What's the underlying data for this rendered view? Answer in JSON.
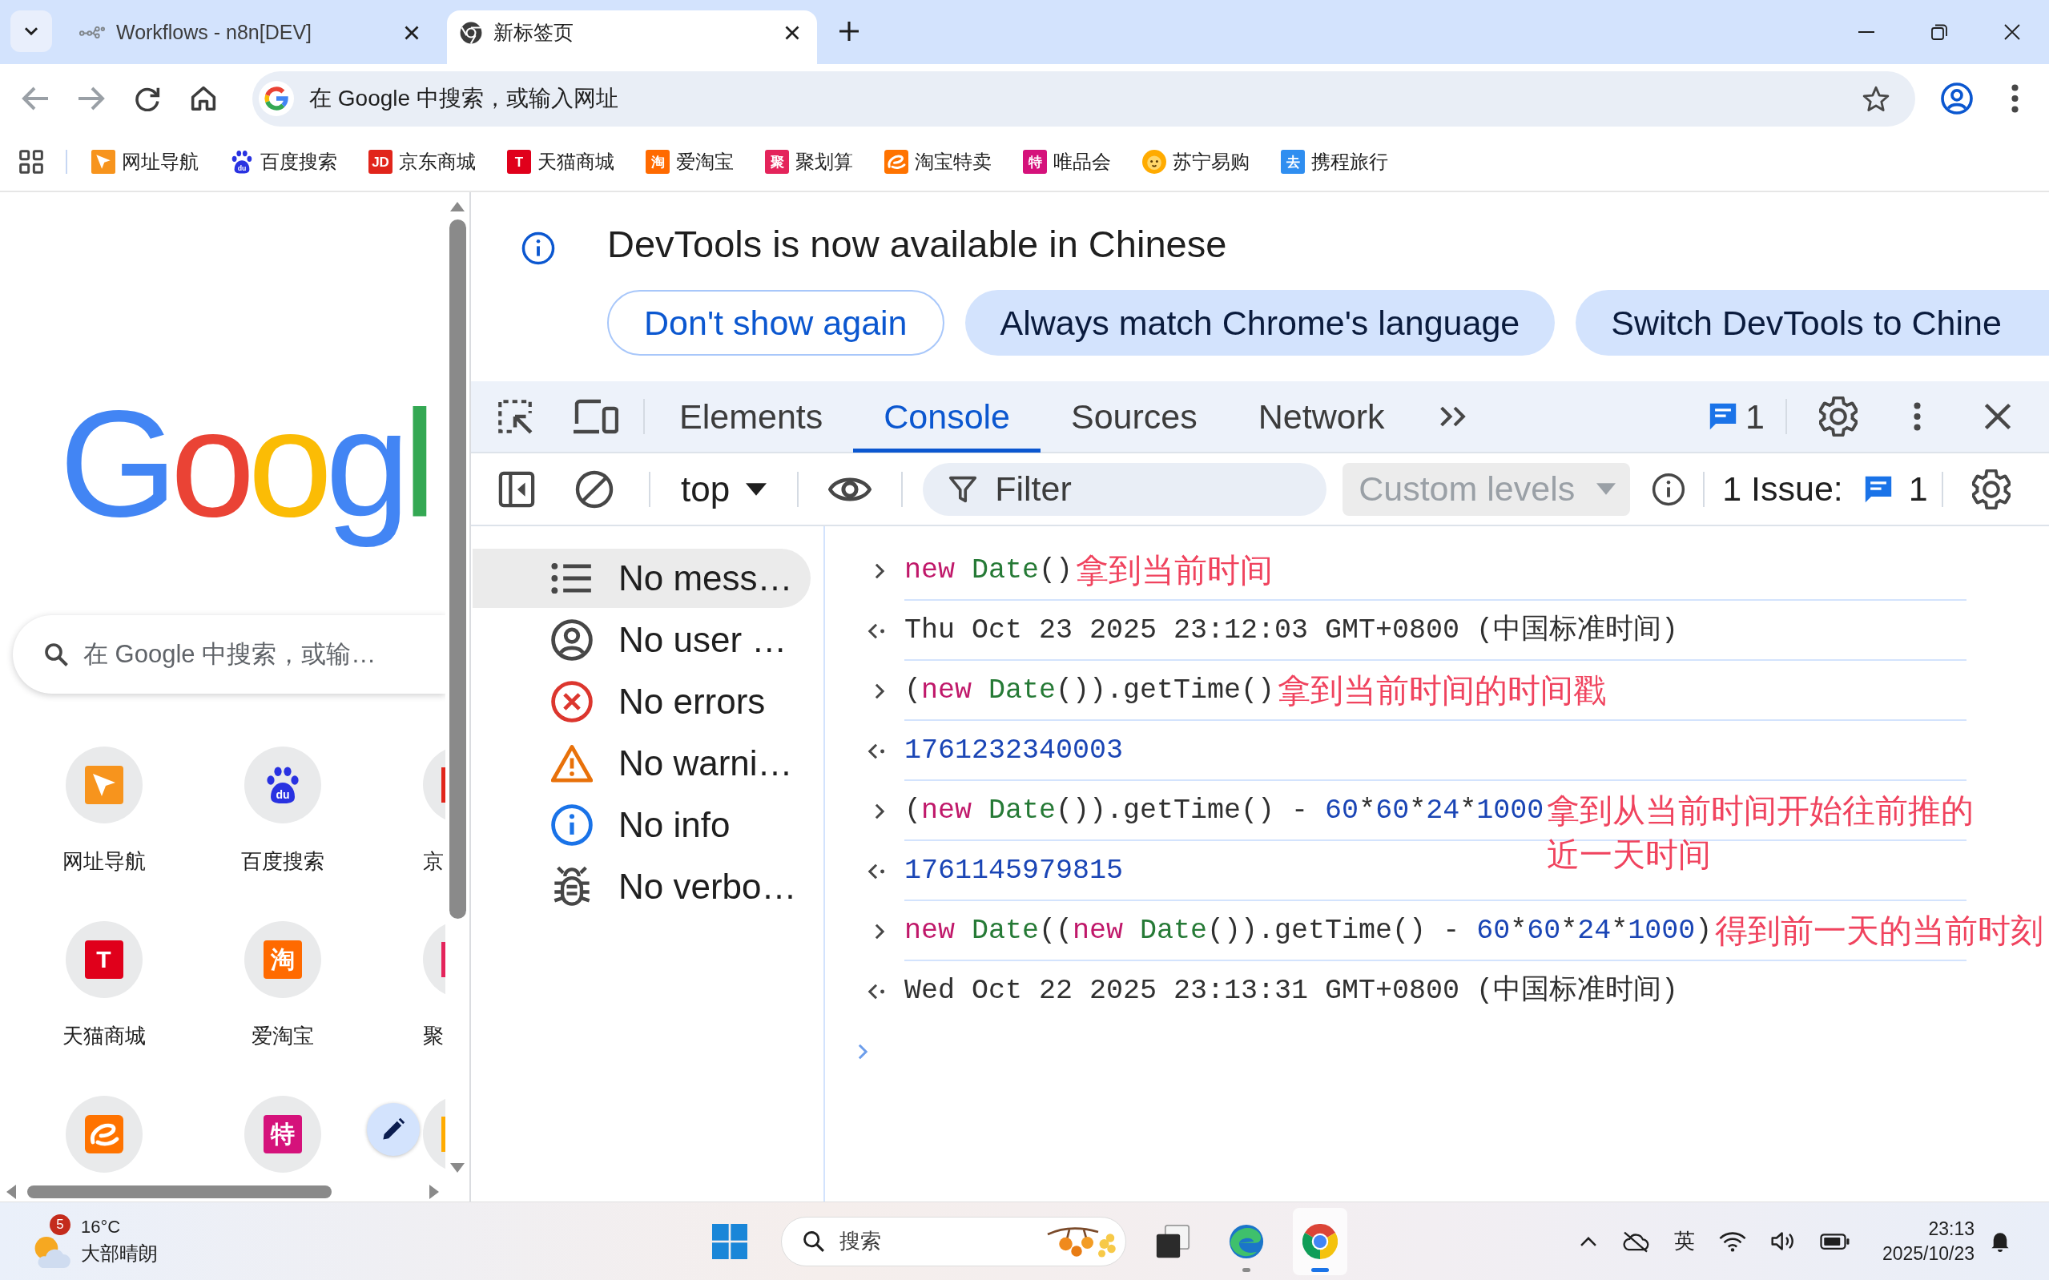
{
  "browser_tabs": [
    {
      "title": "Workflows - n8n[DEV]",
      "kind": "nodes",
      "selected": false
    },
    {
      "title": "新标签页",
      "kind": "chrome",
      "selected": true
    }
  ],
  "toolbar": {
    "nav_buttons": [
      {
        "kind": "back",
        "disabled": true
      },
      {
        "kind": "forward",
        "disabled": true
      },
      {
        "kind": "reload",
        "disabled": false
      },
      {
        "kind": "home",
        "disabled": false
      }
    ],
    "omnibox": {
      "placeholder": "在 Google 中搜索，或输入网址"
    }
  },
  "bookmarks": [
    {
      "label": "网址导航",
      "kind": "cursor",
      "color": "#f7941d"
    },
    {
      "label": "百度搜索",
      "kind": "paw",
      "logo_text": "du",
      "color": "#2932e1"
    },
    {
      "label": "京东商城",
      "kind": "letter",
      "logo_text": "JD",
      "color": "#e1251b"
    },
    {
      "label": "天猫商城",
      "kind": "letter",
      "logo_text": "T",
      "color": "#e0001b"
    },
    {
      "label": "爱淘宝",
      "kind": "letter",
      "logo_text": "淘",
      "color": "#ff6a00"
    },
    {
      "label": "聚划算",
      "kind": "letter",
      "logo_text": "聚",
      "color": "#e4245b"
    },
    {
      "label": "淘宝特卖",
      "kind": "swirl",
      "color": "#ff7300"
    },
    {
      "label": "唯品会",
      "kind": "letter",
      "logo_text": "特",
      "color": "#d5127b"
    },
    {
      "label": "苏宁易购",
      "kind": "lion",
      "color": "#ffab00"
    },
    {
      "label": "携程旅行",
      "kind": "letter",
      "logo_text": "去",
      "color": "#2f8ef0"
    }
  ],
  "new_tab_page": {
    "logo": "Googl",
    "search": {
      "placeholder": "在 Google 中搜索，或输…"
    },
    "shortcuts": [
      {
        "label": "网址导航",
        "kind": "cursor",
        "color": "#f7941d",
        "clipped": false
      },
      {
        "label": "百度搜索",
        "kind": "paw",
        "logo_text": "du",
        "color": "#2932e1",
        "clipped": false
      },
      {
        "label": "京",
        "color": "#e1251b",
        "clipped": true
      },
      {
        "label": "天猫商城",
        "kind": "letter",
        "logo_text": "T",
        "color": "#e0001b",
        "clipped": false
      },
      {
        "label": "爱淘宝",
        "kind": "letter",
        "logo_text": "淘",
        "color": "#ff6a00",
        "clipped": false
      },
      {
        "label": "聚",
        "color": "#e4245b",
        "clipped": true
      },
      {
        "kind": "swirl",
        "color": "#ff7300",
        "clipped": false
      },
      {
        "kind": "letter",
        "logo_text": "特",
        "color": "#d5127b",
        "clipped": false
      },
      {
        "color": "#ffab00",
        "clipped": true
      }
    ]
  },
  "devtools": {
    "infobar": {
      "message": "DevTools is now available in Chinese",
      "buttons": [
        {
          "label": "Don't show again",
          "kind": "outlined"
        },
        {
          "label": "Always match Chrome's language",
          "kind": "tonal"
        },
        {
          "label": "Switch DevTools to Chine",
          "kind": "tonal"
        }
      ]
    },
    "tabs": [
      {
        "label": "Elements",
        "selected": false
      },
      {
        "label": "Console",
        "selected": true
      },
      {
        "label": "Sources",
        "selected": false
      },
      {
        "label": "Network",
        "selected": false
      }
    ],
    "message_count": "1",
    "console_toolbar": {
      "context": "top",
      "filter": {
        "placeholder": "Filter"
      },
      "levels": {
        "label": "Custom levels",
        "disabled": true
      },
      "issues": {
        "label": "1 Issue:",
        "count": "1"
      }
    },
    "sidebar": [
      {
        "label": "No mess…",
        "kind": "messages",
        "selected": true
      },
      {
        "label": "No user …",
        "kind": "user",
        "selected": false
      },
      {
        "label": "No errors",
        "kind": "errors",
        "selected": false
      },
      {
        "label": "No warni…",
        "kind": "warnings",
        "selected": false
      },
      {
        "label": "No info",
        "kind": "info",
        "selected": false
      },
      {
        "label": "No verbo…",
        "kind": "verbose",
        "selected": false
      }
    ],
    "console": [
      {
        "kind": "input",
        "tokens": [
          {
            "kind": "keyword",
            "text": "new "
          },
          {
            "kind": "class",
            "text": "Date"
          },
          {
            "kind": "plain",
            "text": "()"
          }
        ],
        "note": "拿到当前时间"
      },
      {
        "kind": "output",
        "tokens": [
          {
            "kind": "plain",
            "text": "Thu Oct 23 2025 23:12:03 GMT+0800 (中国标准时间)"
          }
        ]
      },
      {
        "kind": "input",
        "tokens": [
          {
            "kind": "plain",
            "text": "("
          },
          {
            "kind": "keyword",
            "text": "new "
          },
          {
            "kind": "class",
            "text": "Date"
          },
          {
            "kind": "plain",
            "text": "()).getTime()"
          }
        ],
        "note": "拿到当前时间的时间戳"
      },
      {
        "kind": "output",
        "tokens": [
          {
            "kind": "number",
            "text": "1761232340003"
          }
        ]
      },
      {
        "kind": "input",
        "tokens": [
          {
            "kind": "plain",
            "text": "("
          },
          {
            "kind": "keyword",
            "text": "new "
          },
          {
            "kind": "class",
            "text": "Date"
          },
          {
            "kind": "plain",
            "text": "()).getTime() - "
          },
          {
            "kind": "number",
            "text": "60"
          },
          {
            "kind": "plain",
            "text": "*"
          },
          {
            "kind": "number",
            "text": "60"
          },
          {
            "kind": "plain",
            "text": "*"
          },
          {
            "kind": "number",
            "text": "24"
          },
          {
            "kind": "plain",
            "text": "*"
          },
          {
            "kind": "number",
            "text": "1000"
          }
        ],
        "note": "拿到从当前时间开始往前推的近一天时间"
      },
      {
        "kind": "output",
        "tokens": [
          {
            "kind": "number",
            "text": "1761145979815"
          }
        ]
      },
      {
        "kind": "input",
        "tokens": [
          {
            "kind": "keyword",
            "text": "new "
          },
          {
            "kind": "class",
            "text": "Date"
          },
          {
            "kind": "plain",
            "text": "(("
          },
          {
            "kind": "keyword",
            "text": "new "
          },
          {
            "kind": "class",
            "text": "Date"
          },
          {
            "kind": "plain",
            "text": "()).getTime() - "
          },
          {
            "kind": "number",
            "text": "60"
          },
          {
            "kind": "plain",
            "text": "*"
          },
          {
            "kind": "number",
            "text": "60"
          },
          {
            "kind": "plain",
            "text": "*"
          },
          {
            "kind": "number",
            "text": "24"
          },
          {
            "kind": "plain",
            "text": "*"
          },
          {
            "kind": "number",
            "text": "1000"
          },
          {
            "kind": "plain",
            "text": ")"
          }
        ],
        "note": "得到前一天的当前时刻"
      },
      {
        "kind": "output",
        "tokens": [
          {
            "kind": "plain",
            "text": "Wed Oct 22 2025 23:13:31 GMT+0800 (中国标准时间)"
          }
        ]
      }
    ]
  },
  "taskbar": {
    "weather": {
      "badge": "5",
      "temperature": "16°C",
      "condition": "大部晴朗"
    },
    "search": {
      "placeholder": "搜索"
    },
    "apps": [
      {
        "kind": "start",
        "selected": false,
        "running": false
      },
      {
        "kind": "window",
        "selected": false,
        "running": false
      },
      {
        "kind": "edge",
        "selected": false,
        "running": true
      },
      {
        "kind": "chrome",
        "selected": true,
        "running": true
      }
    ],
    "ime": "英",
    "time": "23:13",
    "date": "2025/10/23"
  }
}
